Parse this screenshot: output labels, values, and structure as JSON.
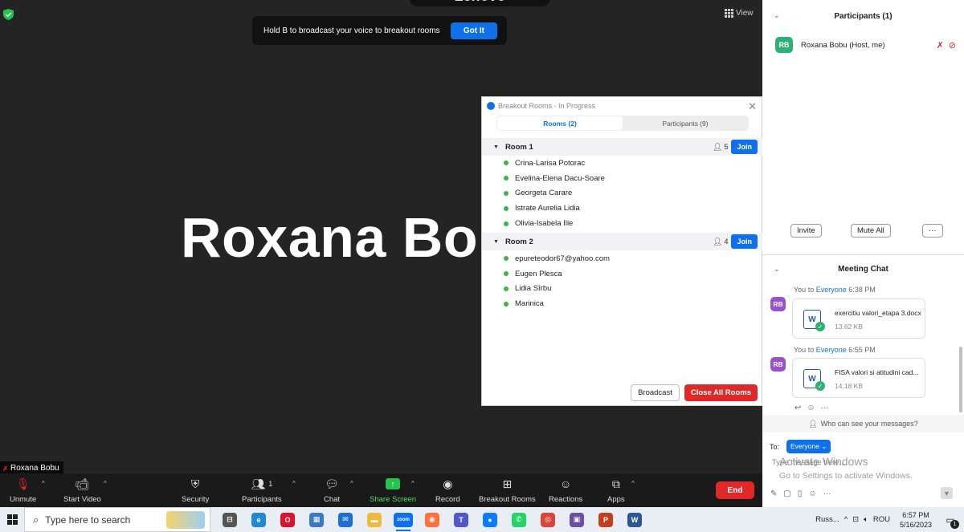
{
  "video": {
    "lenovo_text": "Lenovo",
    "view_label": "View",
    "banner_text": "Hold B to broadcast your voice to breakout rooms",
    "banner_button": "Got It",
    "speaker_name": "Roxana Bo",
    "name_tag": "Roxana Bobu"
  },
  "breakout": {
    "title": "Breakout Rooms - In Progress",
    "tabs": [
      {
        "label": "Rooms (2)",
        "active": true
      },
      {
        "label": "Participants (9)",
        "active": false
      }
    ],
    "rooms": [
      {
        "name": "Room 1",
        "count": "5",
        "join_label": "Join",
        "members": [
          "Crina-Larisa Potorac",
          "Evelina-Elena Dacu-Soare",
          "Georgeta Carare",
          "Istrate Aurelia Lidia",
          "Olivia-Isabela Ilie"
        ]
      },
      {
        "name": "Room 2",
        "count": "4",
        "join_label": "Join",
        "members": [
          "epureteodor67@yahoo.com",
          "Eugen Plesca",
          "Lidia Sîrbu",
          "Marinica"
        ]
      }
    ],
    "broadcast_label": "Broadcast",
    "close_all_label": "Close All Rooms"
  },
  "participants": {
    "title": "Participants (1)",
    "list": [
      {
        "initials": "RB",
        "name": "Roxana Bobu (Host, me)"
      }
    ],
    "invite_label": "Invite",
    "mute_all_label": "Mute All",
    "more_label": "···"
  },
  "chat": {
    "title": "Meeting Chat",
    "messages": [
      {
        "initials": "RB",
        "prefix": "You to",
        "to": "Everyone",
        "time": "6:38 PM",
        "file_name": "exercitiu valori_etapa 3.docx",
        "file_size": "13.62 KB"
      },
      {
        "initials": "RB",
        "prefix": "You to",
        "to": "Everyone",
        "time": "6:55 PM",
        "file_name": "FISA  valori si atitudini cad...",
        "file_size": "14.18 KB"
      }
    ],
    "who_can_see": "Who can see your messages?",
    "to_label": "To:",
    "recipient": "Everyone",
    "placeholder": "Type message here...",
    "activate_title": "Activate Windows",
    "activate_sub": "Go to Settings to activate Windows."
  },
  "toolbar": {
    "unmute": "Unmute",
    "start_video": "Start Video",
    "security": "Security",
    "participants": "Participants",
    "participants_count": "1",
    "chat": "Chat",
    "share_screen": "Share Screen",
    "record": "Record",
    "breakout_rooms": "Breakout Rooms",
    "reactions": "Reactions",
    "apps": "Apps",
    "end": "End"
  },
  "taskbar": {
    "search_placeholder": "Type here to search",
    "tray_app": "Russ...",
    "language": "ROU",
    "time": "6:57 PM",
    "date": "5/16/2023",
    "notif_count": "1",
    "apps": [
      {
        "name": "task-view",
        "color": "#555555",
        "glyph": "⊟"
      },
      {
        "name": "edge",
        "color": "#1f8ad2",
        "glyph": "e"
      },
      {
        "name": "opera",
        "color": "#e0102b",
        "glyph": "O"
      },
      {
        "name": "store",
        "color": "#3a78c9",
        "glyph": "▦"
      },
      {
        "name": "mail",
        "color": "#1d6fd8",
        "glyph": "✉"
      },
      {
        "name": "file-explorer",
        "color": "#f3b93a",
        "glyph": "▬"
      },
      {
        "name": "zoom",
        "color": "#0e71eb",
        "glyph": "zoom",
        "active": true
      },
      {
        "name": "firefox",
        "color": "#ff7139",
        "glyph": "◉"
      },
      {
        "name": "teams",
        "color": "#5059c9",
        "glyph": "T"
      },
      {
        "name": "messenger",
        "color": "#0a7cff",
        "glyph": "●"
      },
      {
        "name": "whatsapp",
        "color": "#25d366",
        "glyph": "✆"
      },
      {
        "name": "chrome",
        "color": "#db4437",
        "glyph": "◎"
      },
      {
        "name": "save-app",
        "color": "#6b4fa3",
        "glyph": "▣"
      },
      {
        "name": "powerpoint",
        "color": "#c43e1c",
        "glyph": "P"
      },
      {
        "name": "word",
        "color": "#2b579a",
        "glyph": "W"
      }
    ]
  }
}
